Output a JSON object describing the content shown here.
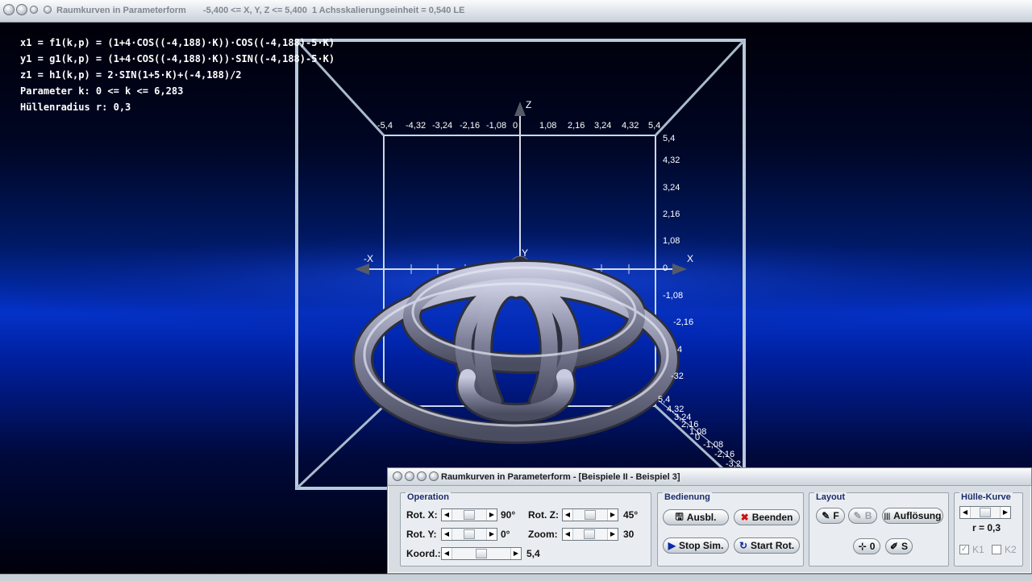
{
  "window": {
    "title": "Raumkurven in Parameterform",
    "range": "-5,400 <= X, Y, Z <= 5,400",
    "scale": "1 Achsskalierungseinheit = 0,540 LE"
  },
  "formulas": {
    "x1": "x1 = f1(k,p) = (1+4·COS((-4,188)·K))·COS((-4,188)-5·K)",
    "y1": "y1 = g1(k,p) = (1+4·COS((-4,188)·K))·SIN((-4,188)-5·K)",
    "z1": "z1 = h1(k,p) = 2·SIN(1+5·K)+(-4,188)/2",
    "param": "Parameter k: 0 <= k <= 6,283",
    "radius": "Hüllenradius r: 0,3"
  },
  "axes": {
    "x_label": "X",
    "x_neg_label": "-X",
    "y_label": "Y",
    "z_label": "Z",
    "top_ticks": [
      "-5,4",
      "-4,32",
      "-3,24",
      "-2,16",
      "-1,08",
      "0",
      "1,08",
      "2,16",
      "3,24",
      "4,32",
      "5,4"
    ],
    "right_ticks": [
      "5,4",
      "4,32",
      "3,24",
      "2,16",
      "1,08",
      "0",
      "-1,08",
      "-2,16",
      "4",
      "-32"
    ],
    "diag_ticks": [
      "5,4",
      "4,32",
      "3,24",
      "2,16",
      "1,08",
      "0",
      "-1,08",
      "-2,16",
      "-3,2"
    ]
  },
  "dialog": {
    "title": "Raumkurven in Parameterform - [Beispiele II - Beispiel 3]",
    "operation": {
      "title": "Operation",
      "rot_x_label": "Rot. X:",
      "rot_x_value": "90°",
      "rot_y_label": "Rot. Y:",
      "rot_y_value": "0°",
      "rot_z_label": "Rot. Z:",
      "rot_z_value": "45°",
      "zoom_label": "Zoom:",
      "zoom_value": "30",
      "koord_label": "Koord.:",
      "koord_value": "5,4",
      "rot_x_level": 0.5,
      "rot_y_level": 0.5,
      "rot_z_level": 0.5,
      "zoom_level": 0.45,
      "koord_level": 0.5
    },
    "bedienung": {
      "title": "Bedienung",
      "ausbl": "Ausbl.",
      "beenden": "Beenden",
      "stop_sim": "Stop Sim.",
      "start_rot": "Start Rot."
    },
    "layout": {
      "title": "Layout",
      "f": "F",
      "b": "B",
      "aufloesung": "Auflösung",
      "o": "0",
      "s": "S"
    },
    "huelle": {
      "title": "Hülle-Kurve",
      "r_value": "r = 0,3",
      "k1": "K1",
      "k2": "K2",
      "k1_checked": true,
      "k2_checked": false
    }
  },
  "colors": {
    "box": "#c8d8e8",
    "tube": "#8c8fa8",
    "accent_blue": "#1c2c6c"
  }
}
